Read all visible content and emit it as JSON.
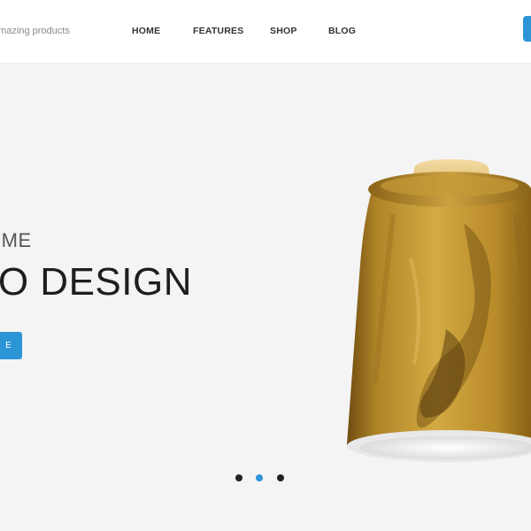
{
  "header": {
    "tagline": "amazing products",
    "nav": [
      {
        "label": "HOME"
      },
      {
        "label": "FEATURES"
      },
      {
        "label": "SHOP"
      },
      {
        "label": "BLOG"
      }
    ]
  },
  "hero": {
    "kicker": "OME",
    "title": "BO DESIGN",
    "button_label": "E",
    "slide_dots": {
      "count": 3,
      "active_index": 1
    }
  },
  "colors": {
    "accent": "#2b95d6",
    "hero_background": "#f4f4f4",
    "dot_inactive": "#222222",
    "lamp_amber": "#b88a22"
  },
  "icons": {
    "lamp_image": "wooden-amber-pendant-lamp-shade"
  }
}
